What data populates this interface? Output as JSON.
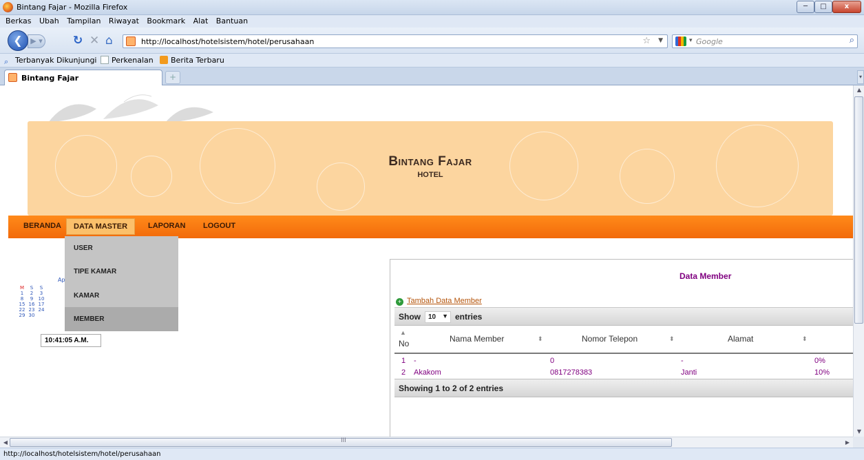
{
  "window": {
    "title": "Bintang Fajar - Mozilla Firefox",
    "minimize": "─",
    "maximize": "□",
    "close": "x"
  },
  "menubar": [
    "Berkas",
    "Ubah",
    "Tampilan",
    "Riwayat",
    "Bookmark",
    "Alat",
    "Bantuan"
  ],
  "navbar": {
    "url": "http://localhost/hotelsistem/hotel/perusahaan",
    "search_placeholder": "Google"
  },
  "bookmarks": [
    "Terbanyak Dikunjungi",
    "Perkenalan",
    "Berita Terbaru"
  ],
  "tabs": [
    {
      "label": "Bintang Fajar"
    }
  ],
  "page": {
    "brand_name": "Bintang Fajar",
    "brand_sub": "HOTEL",
    "nav": [
      "BERANDA",
      "DATA MASTER",
      "LAPORAN",
      "LOGOUT"
    ],
    "active_nav": "DATA MASTER",
    "dropdown": [
      "USER",
      "TIPE KAMAR",
      "KAMAR",
      "MEMBER"
    ],
    "dropdown_highlight": "MEMBER",
    "calendar": {
      "month_partial": "Ap",
      "headers": [
        "M",
        "S",
        "S"
      ],
      "rows": [
        [
          "1",
          "2",
          "3"
        ],
        [
          "8",
          "9",
          "10"
        ],
        [
          "15",
          "16",
          "17"
        ],
        [
          "22",
          "23",
          "24"
        ],
        [
          "29",
          "30",
          ""
        ]
      ]
    },
    "clock": "10:41:05 A.M.",
    "panel": {
      "title": "Data Member",
      "add_link": "Tambah Data Member",
      "show_label": "Show",
      "show_value": "10",
      "entries_label": "entries",
      "columns": [
        "No",
        "Nama Member",
        "Nomor Telepon",
        "Alamat"
      ],
      "rows": [
        {
          "no": "1",
          "nama": "-",
          "telepon": "0",
          "alamat": "-",
          "diskon": "0%"
        },
        {
          "no": "2",
          "nama": "Akakom",
          "telepon": "0817278383",
          "alamat": "Janti",
          "diskon": "10%"
        }
      ],
      "footer": "Showing 1 to 2 of 2 entries"
    }
  },
  "status_text": "http://localhost/hotelsistem/hotel/perusahaan",
  "colors": {
    "header_bg": "#fcd59f",
    "nav_bg": "#f26a0a",
    "accent_purple": "#800080",
    "link_orange": "#b45309"
  }
}
